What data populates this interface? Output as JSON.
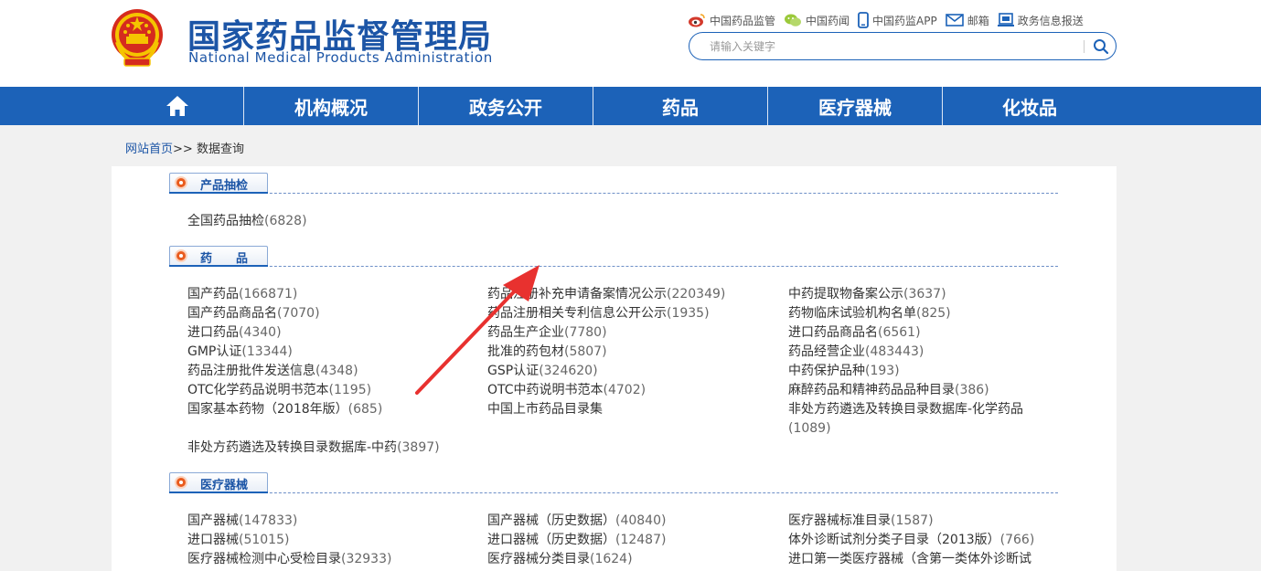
{
  "site": {
    "name_cn": "国家药品监督管理局",
    "name_en": "National Medical Products Administration"
  },
  "toplinks": [
    {
      "label": "中国药品监管",
      "icon": "weibo-icon"
    },
    {
      "label": "中国药闻",
      "icon": "wechat-icon"
    },
    {
      "label": "中国药监APP",
      "icon": "mobile-icon"
    },
    {
      "label": "邮箱",
      "icon": "mail-icon"
    },
    {
      "label": "政务信息报送",
      "icon": "report-icon"
    }
  ],
  "search": {
    "placeholder": "请输入关键字",
    "icon": "search-icon"
  },
  "nav": [
    {
      "label": "",
      "icon": "home-icon"
    },
    {
      "label": "机构概况"
    },
    {
      "label": "政务公开"
    },
    {
      "label": "药品"
    },
    {
      "label": "医疗器械"
    },
    {
      "label": "化妆品"
    }
  ],
  "breadcrumb": {
    "home": "网站首页",
    "sep": ">>",
    "current": "数据查询"
  },
  "sections": [
    {
      "title": "产品抽检",
      "items": [
        {
          "name": "全国药品抽检",
          "count": "(6828)"
        }
      ]
    },
    {
      "title": "药　　品",
      "items": [
        {
          "name": "国产药品",
          "count": "(166871)"
        },
        {
          "name": "药品注册补充申请备案情况公示",
          "count": "(220349)"
        },
        {
          "name": "中药提取物备案公示",
          "count": "(3637)"
        },
        {
          "name": "国产药品商品名",
          "count": "(7070)"
        },
        {
          "name": "药品注册相关专利信息公开公示",
          "count": "(1935)"
        },
        {
          "name": "药物临床试验机构名单",
          "count": "(825)"
        },
        {
          "name": "进口药品",
          "count": "(4340)"
        },
        {
          "name": "药品生产企业",
          "count": "(7780)"
        },
        {
          "name": "进口药品商品名",
          "count": "(6561)"
        },
        {
          "name": "GMP认证",
          "count": "(13344)"
        },
        {
          "name": "批准的药包材",
          "count": "(5807)"
        },
        {
          "name": "药品经营企业",
          "count": "(483443)"
        },
        {
          "name": "药品注册批件发送信息",
          "count": "(4348)"
        },
        {
          "name": "GSP认证",
          "count": "(324620)"
        },
        {
          "name": "中药保护品种",
          "count": "(193)"
        },
        {
          "name": "OTC化学药品说明书范本",
          "count": "(1195)"
        },
        {
          "name": "OTC中药说明书范本",
          "count": "(4702)"
        },
        {
          "name": "麻醉药品和精神药品品种目录",
          "count": "(386)"
        },
        {
          "name": "国家基本药物（2018年版）",
          "count": "(685)"
        },
        {
          "name": "中国上市药品目录集",
          "count": ""
        },
        {
          "name": "非处方药遴选及转换目录数据库-化学药品",
          "count": ""
        },
        {
          "name": "",
          "count": "(1089)"
        },
        {
          "name": "非处方药遴选及转换目录数据库-中药",
          "count": "(3897)"
        }
      ]
    },
    {
      "title": "医疗器械",
      "items": [
        {
          "name": "国产器械",
          "count": "(147833)"
        },
        {
          "name": "国产器械（历史数据）",
          "count": "(40840)"
        },
        {
          "name": "医疗器械标准目录",
          "count": "(1587)"
        },
        {
          "name": "进口器械",
          "count": "(51015)"
        },
        {
          "name": "进口器械（历史数据）",
          "count": "(12487)"
        },
        {
          "name": "体外诊断试剂分类子目录（2013版）",
          "count": "(766)"
        },
        {
          "name": "医疗器械检测中心受检目录",
          "count": "(32933)"
        },
        {
          "name": "医疗器械分类目录",
          "count": "(1624)"
        },
        {
          "name": "进口第一类医疗器械（含第一类体外诊断试",
          "count": ""
        }
      ]
    }
  ],
  "colors": {
    "brand": "#1c62b8",
    "accent": "#e95b1e",
    "arrow": "#e8312f"
  }
}
